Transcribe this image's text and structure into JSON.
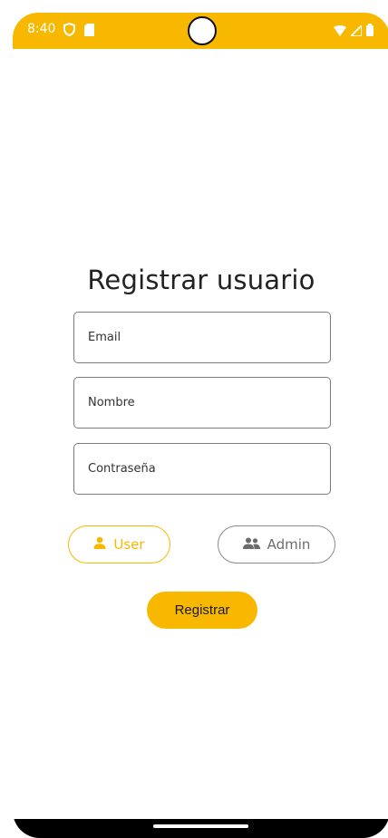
{
  "status_bar": {
    "time": "8:40",
    "bg_color": "#f9b800",
    "icons": [
      "shield-icon",
      "sd-card-icon",
      "wifi-icon",
      "signal-icon",
      "battery-icon"
    ]
  },
  "form": {
    "title": "Registrar usuario",
    "email_placeholder": "Email",
    "name_placeholder": "Nombre",
    "password_placeholder": "Contraseña"
  },
  "roles": {
    "user_label": "User",
    "admin_label": "Admin",
    "selected": "User",
    "accent_color": "#f9b800"
  },
  "actions": {
    "register_label": "Registrar"
  }
}
